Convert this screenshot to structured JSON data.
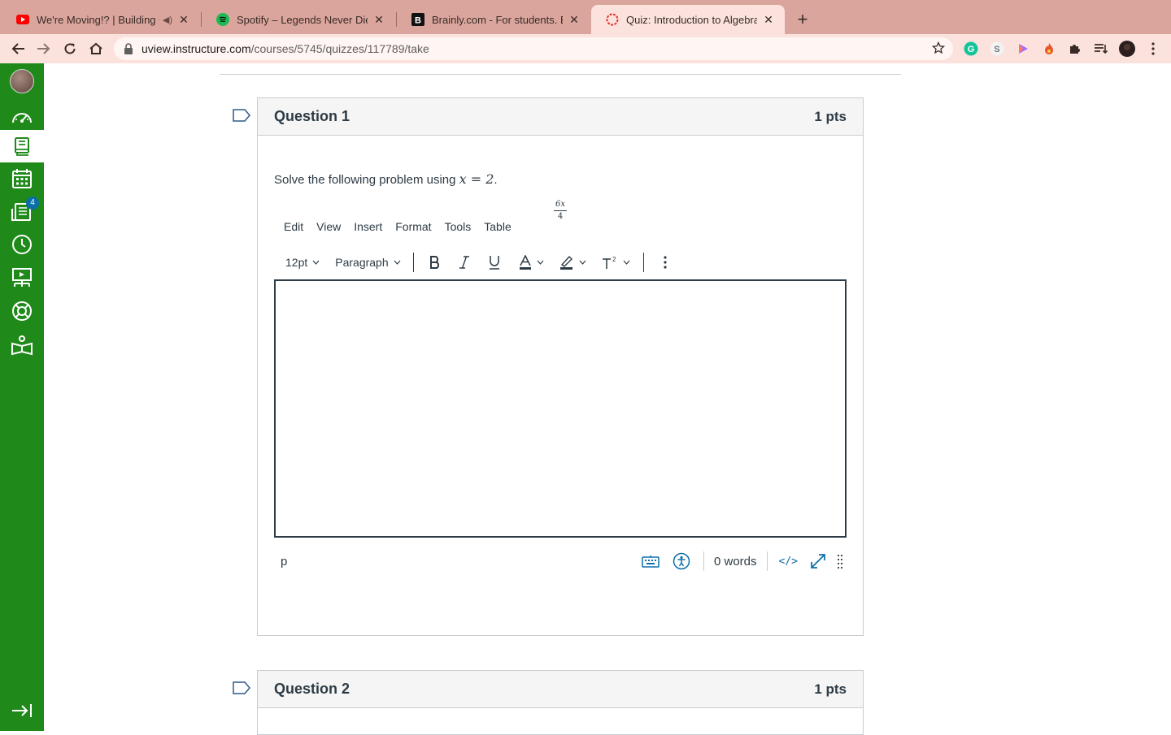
{
  "browser": {
    "tabs": [
      {
        "title": "We're Moving!? | Building C",
        "favicon": "youtube-icon",
        "audio": true,
        "active": false
      },
      {
        "title": "Spotify – Legends Never Die",
        "favicon": "spotify-icon",
        "active": false
      },
      {
        "title": "Brainly.com - For students. By",
        "favicon": "brainly-icon",
        "active": false
      },
      {
        "title": "Quiz: Introduction to Algebra",
        "favicon": "canvas-icon",
        "active": true
      }
    ],
    "url_host": "uview.instructure.com",
    "url_path": "/courses/5745/quizzes/117789/take"
  },
  "global_nav": {
    "items": [
      "account",
      "dashboard",
      "courses",
      "calendar",
      "inbox",
      "history",
      "commons",
      "help",
      "library"
    ],
    "active": "courses",
    "inbox_badge": "4",
    "collapse": "collapse-nav"
  },
  "questions": [
    {
      "name": "Question 1",
      "points": "1 pts",
      "prompt_text": "Solve the following problem using ",
      "prompt_math": "x = 2",
      "prompt_end": ".",
      "fraction_num": "6x",
      "fraction_den": "4",
      "editor": {
        "menus": [
          "Edit",
          "View",
          "Insert",
          "Format",
          "Tools",
          "Table"
        ],
        "font_size": "12pt",
        "block_format": "Paragraph",
        "path": "p",
        "word_count": "0 words",
        "html_toggle": "</>"
      }
    },
    {
      "name": "Question 2",
      "points": "1 pts"
    }
  ],
  "colors": {
    "nav": "#1f8a1a",
    "accent": "#0b6ea9",
    "tabbar": "#d9a59c"
  }
}
